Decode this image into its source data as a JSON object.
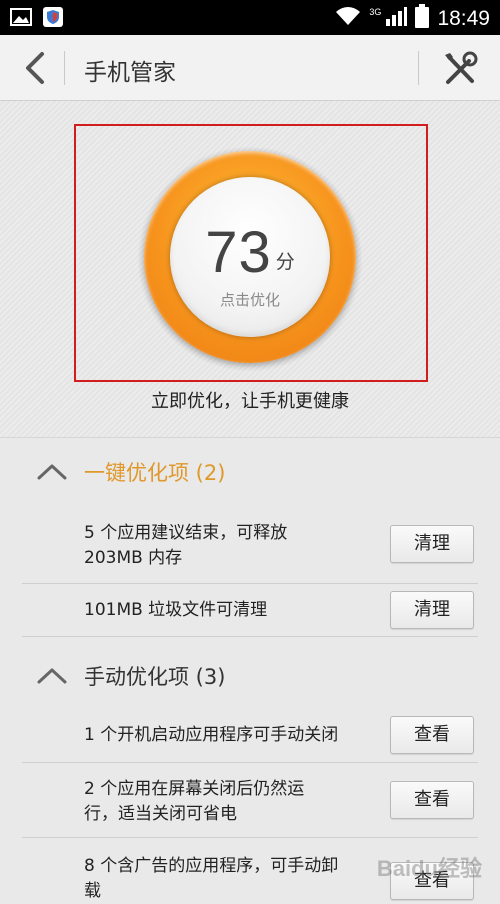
{
  "status_bar": {
    "network": "3G",
    "time": "18:49"
  },
  "header": {
    "title": "手机管家"
  },
  "score": {
    "value": "73",
    "unit": "分",
    "action_label": "点击优化",
    "caption": "立即优化，让手机更健康"
  },
  "sections": [
    {
      "title": "一键优化项 (2)",
      "color": "#e0982a",
      "items": [
        {
          "lines": [
            "5 个应用建议结束，可释放",
            "203MB 内存"
          ],
          "button": "清理"
        },
        {
          "lines": [
            "101MB 垃圾文件可清理"
          ],
          "button": "清理"
        }
      ]
    },
    {
      "title": "手动优化项 (3)",
      "color": "#333333",
      "items": [
        {
          "lines": [
            "1 个开机启动应用程序可手动关闭"
          ],
          "button": "查看"
        },
        {
          "lines": [
            "2 个应用在屏幕关闭后仍然运",
            "行，适当关闭可省电"
          ],
          "button": "查看"
        },
        {
          "lines": [
            "8 个含广告的应用程序，可手动卸",
            "载"
          ],
          "button": "查看"
        }
      ]
    }
  ],
  "watermark": "Baidu经验"
}
